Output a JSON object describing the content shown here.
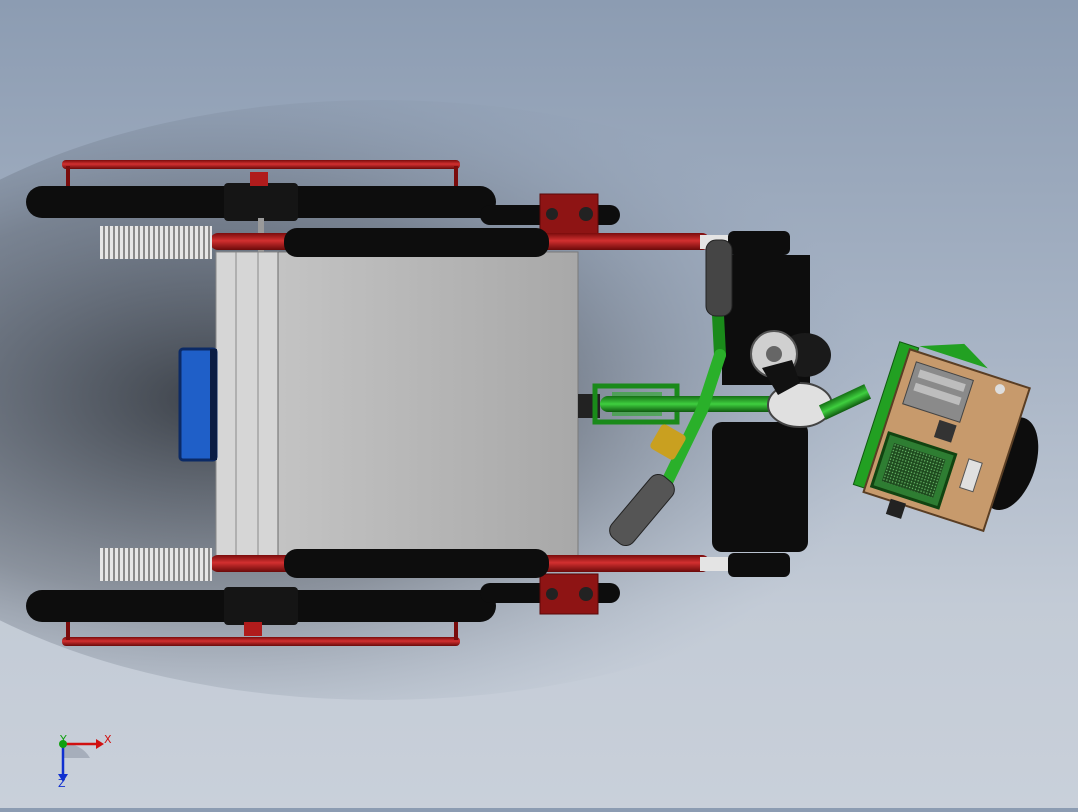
{
  "viewport": {
    "background_top": "#8c9cb2",
    "background_bottom": "#c9d0da"
  },
  "model": {
    "frame_color": "#a01818",
    "steering_color": "#22a022",
    "tire_color": "#0d0d0d",
    "deck_color": "#b3b3b3",
    "battery_color": "#1f5fc8",
    "engine_box_color": "#c79a6c",
    "filter_color": "#2e7d32"
  },
  "triad": {
    "x_label": "X",
    "y_label": "Y",
    "z_label": "Z",
    "x_color": "#d01010",
    "y_color": "#10a010",
    "z_color": "#1030d0"
  }
}
